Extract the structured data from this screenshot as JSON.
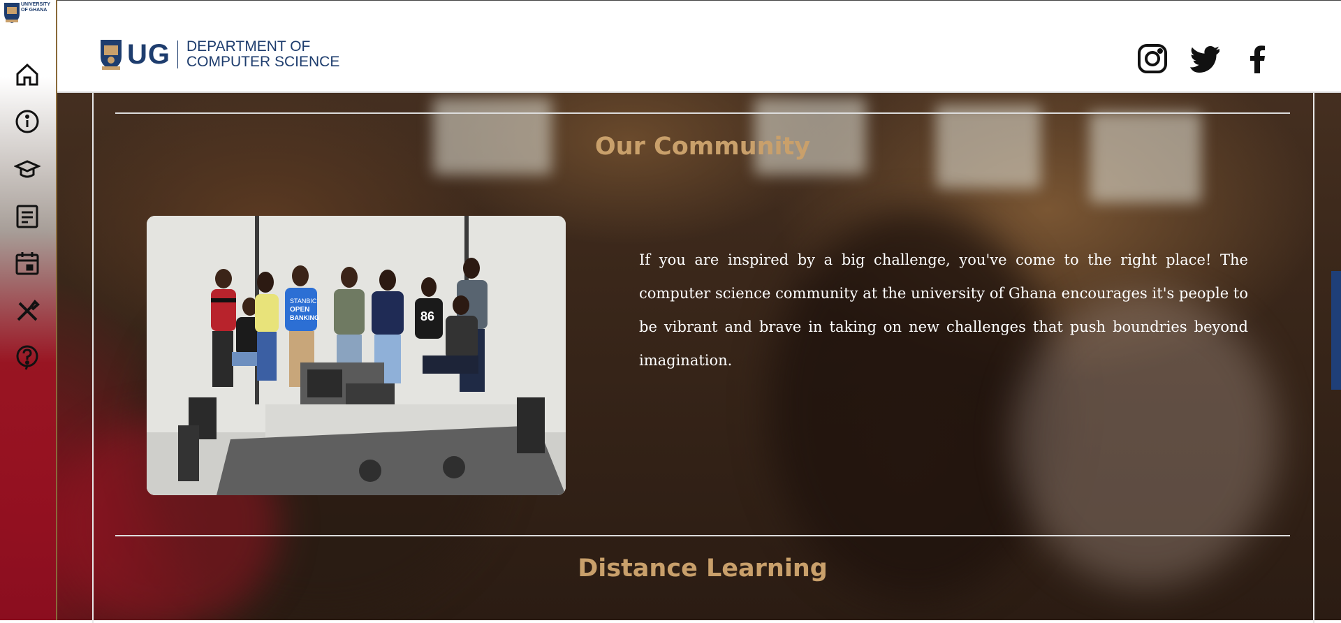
{
  "rail": {
    "crest_text": "UNIVERSITY OF GHANA",
    "nav": [
      {
        "name": "home-icon"
      },
      {
        "name": "info-icon"
      },
      {
        "name": "graduation-cap-icon"
      },
      {
        "name": "document-icon"
      },
      {
        "name": "calendar-icon"
      },
      {
        "name": "tools-icon"
      },
      {
        "name": "help-icon"
      }
    ]
  },
  "header": {
    "logo_short": "UG",
    "dept_line1": "DEPARTMENT OF",
    "dept_line2": "COMPUTER SCIENCE",
    "social": [
      "instagram-icon",
      "twitter-icon",
      "facebook-icon"
    ]
  },
  "community": {
    "title": "Our Community",
    "text": "If you are inspired by a big challenge, you've come to the right place! The computer science community at the university of Ghana encourages it's people to be vibrant and brave in taking on new challenges that push boundries beyond imagination.",
    "photo_badges": [
      "STANBIC",
      "OPEN",
      "BANKING",
      "86"
    ]
  },
  "distance": {
    "title": "Distance Learning"
  },
  "colors": {
    "accent_gold": "#c9a06b",
    "brand_blue": "#1e3d6e",
    "rail_red": "#8b0e1f"
  }
}
